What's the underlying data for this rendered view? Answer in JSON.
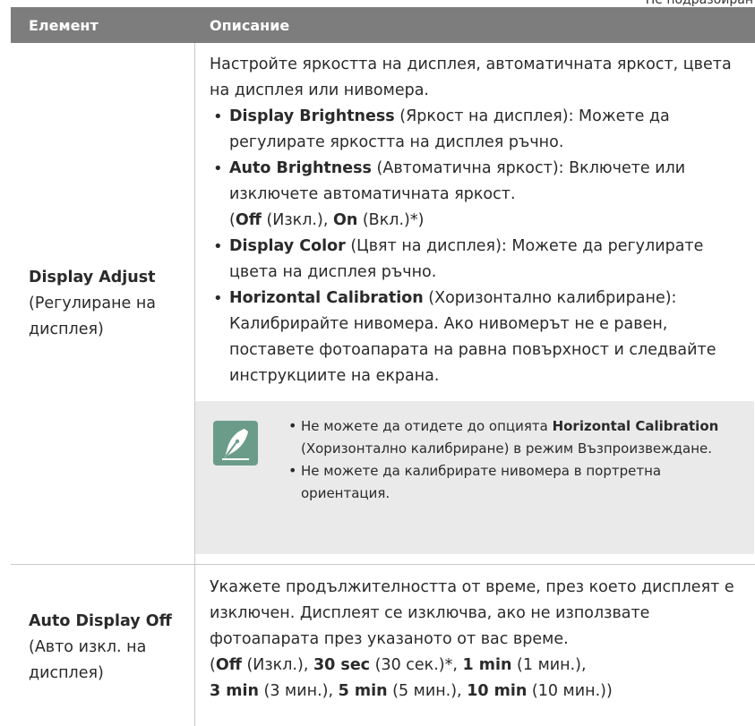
{
  "page": {
    "clip_note": "Не подразбиран"
  },
  "table": {
    "headers": {
      "element": "Елемент",
      "description": "Описание"
    },
    "rows": [
      {
        "element_name": "Display Adjust",
        "element_sub": "(Регулиране на дисплея)",
        "intro": "Настройте яркостта на дисплея, автоматичната яркост, цвета на дисплея или нивомера.",
        "bullets": [
          {
            "bold": "Display Brightness",
            "rest": " (Яркост на дисплея): Можете да регулирате яркостта на дисплея ръчно."
          },
          {
            "bold": "Auto Brightness",
            "rest": " (Автоматична яркост): Включете или изключете автоматичната яркост.",
            "opt_open": "(",
            "opt1_bold": "Off",
            "opt1_rest": " (Изкл.), ",
            "opt2_bold": "On",
            "opt2_rest": " (Вкл.)*)"
          },
          {
            "bold": "Display Color",
            "rest": " (Цвят на дисплея): Можете да регулирате цвета на дисплея ръчно."
          },
          {
            "bold": "Horizontal Calibration",
            "rest": " (Хоризонтално калибриране): Калибрирайте нивомера. Ако нивомерът не е равен, поставете фотоапарата на равна повърхност и следвайте инструкциите на екрана."
          }
        ],
        "note": {
          "icon": "pen-nib-icon",
          "items": [
            {
              "pre": "Не можете да отидете до опцията ",
              "bold": "Horizontal Calibration",
              "post": " (Хоризонтално калибриране) в режим Възпроизвеждане."
            },
            {
              "pre": "Не можете да калибрирате нивомера в портретна ориентация.",
              "bold": "",
              "post": ""
            }
          ]
        }
      },
      {
        "element_name": "Auto Display Off",
        "element_sub": "(Авто изкл. на дисплея)",
        "intro": "Укажете продължителността от време, през което дисплеят е изключен. Дисплеят се изключва, ако не използвате фотоапарата през указаното от вас време.",
        "options": [
          {
            "bold": "Off",
            "rest": " (Изкл.), "
          },
          {
            "bold": "30 sec",
            "rest": " (30 сек.)*, "
          },
          {
            "bold": "1 min",
            "rest": " (1 мин.), "
          },
          {
            "bold": "3 min",
            "rest": " (3 мин.), "
          },
          {
            "bold": "5 min",
            "rest": " (5 мин.), "
          },
          {
            "bold": "10 min",
            "rest": " (10 мин.))"
          }
        ]
      }
    ]
  },
  "colors": {
    "header_bg": "#7d7d7d",
    "note_bg": "#eaeaea",
    "icon_bg": "#6b9c8a"
  }
}
